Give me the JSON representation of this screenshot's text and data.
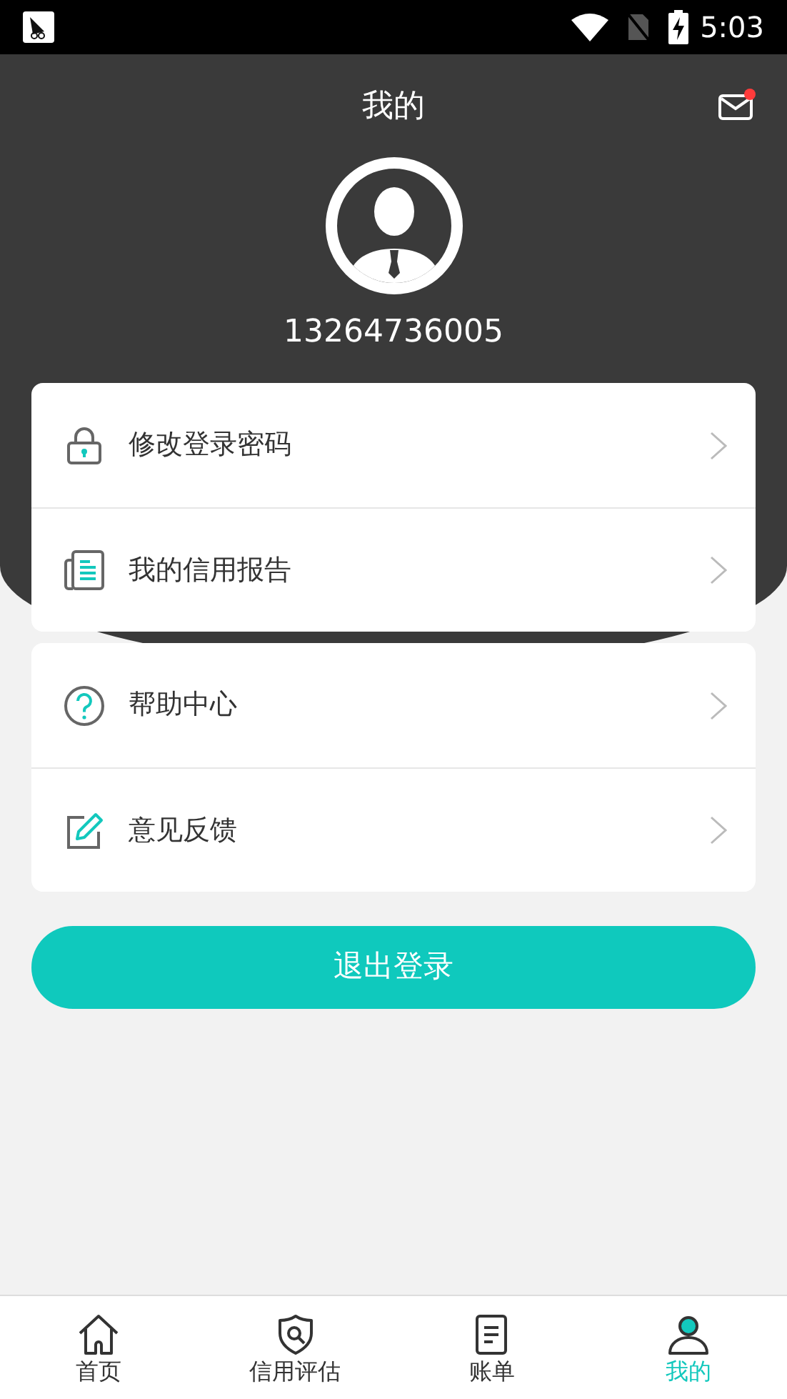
{
  "status_bar": {
    "time": "5:03"
  },
  "header": {
    "title": "我的",
    "unread": true
  },
  "profile": {
    "phone": "13264736005"
  },
  "menu_groups": [
    {
      "items": [
        {
          "label": "修改登录密码"
        },
        {
          "label": "我的信用报告"
        }
      ]
    },
    {
      "items": [
        {
          "label": "帮助中心"
        },
        {
          "label": "意见反馈"
        }
      ]
    }
  ],
  "logout_button": "退出登录",
  "tabs": [
    {
      "label": "首页",
      "selected": false
    },
    {
      "label": "信用评估",
      "selected": false
    },
    {
      "label": "账单",
      "selected": false
    },
    {
      "label": "我的",
      "selected": true
    }
  ]
}
